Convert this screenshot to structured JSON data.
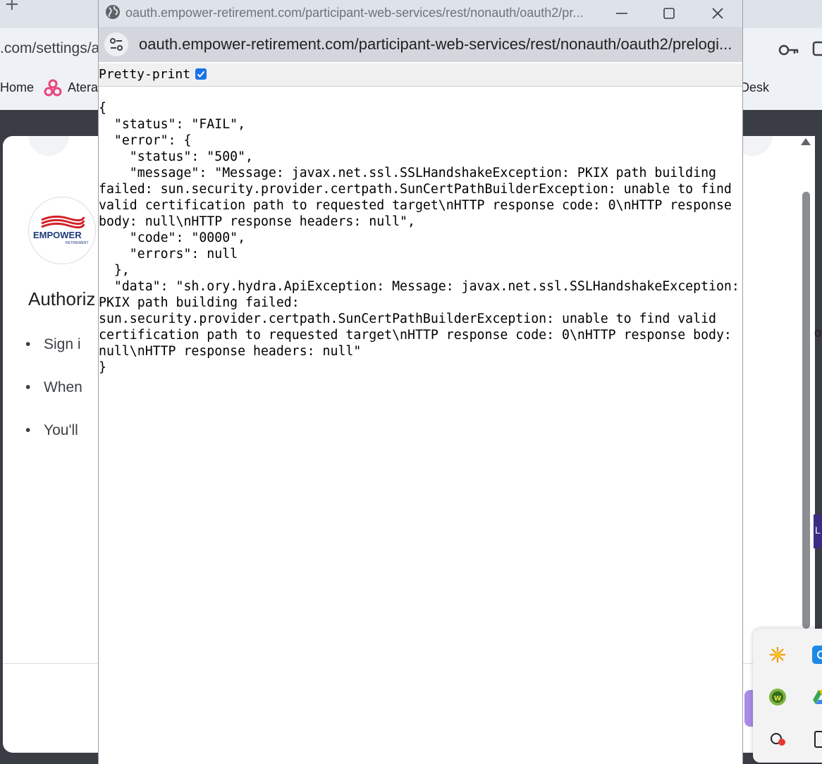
{
  "background_browser": {
    "new_tab_symbol": "+",
    "url_fragment": ".com/settings/a",
    "bookmarks": [
      {
        "label": "Home"
      },
      {
        "label": "Atera"
      },
      {
        "label": "Desk"
      }
    ],
    "card": {
      "logo_text": "EMPOWER",
      "logo_subtext": "RETIREMENT",
      "heading": "Authoriz",
      "bullets": [
        "Sign i",
        "When",
        "You'll"
      ]
    },
    "edge_strip_letter": "L",
    "edge_text_fragment": "o"
  },
  "popup": {
    "title": "oauth.empower-retirement.com/participant-web-services/rest/nonauth/oauth2/pr...",
    "url": "oauth.empower-retirement.com/participant-web-services/rest/nonauth/oauth2/prelogi...",
    "pretty_print_label": "Pretty-print",
    "pretty_print_checked": true,
    "json_lines": [
      "{",
      "  \"status\": \"FAIL\",",
      "  \"error\": {",
      "    \"status\": \"500\",",
      "    \"message\": \"Message: javax.net.ssl.SSLHandshakeException: PKIX path building",
      "failed: sun.security.provider.certpath.SunCertPathBuilderException: unable to find",
      "valid certification path to requested target\\nHTTP response code: 0\\nHTTP response",
      "body: null\\nHTTP response headers: null\",",
      "    \"code\": \"0000\",",
      "    \"errors\": null",
      "  },",
      "  \"data\": \"sh.ory.hydra.ApiException: Message: javax.net.ssl.SSLHandshakeException:",
      "PKIX path building failed:",
      "sun.security.provider.certpath.SunCertPathBuilderException: unable to find valid",
      "certification path to requested target\\nHTTP response code: 0\\nHTTP response body:",
      "null\\nHTTP response headers: null\"",
      "}"
    ]
  },
  "colors": {
    "accent": "#1a73e8",
    "brand_red": "#d2232a",
    "brand_navy": "#1d3a78",
    "purple_button": "#a98be8"
  }
}
